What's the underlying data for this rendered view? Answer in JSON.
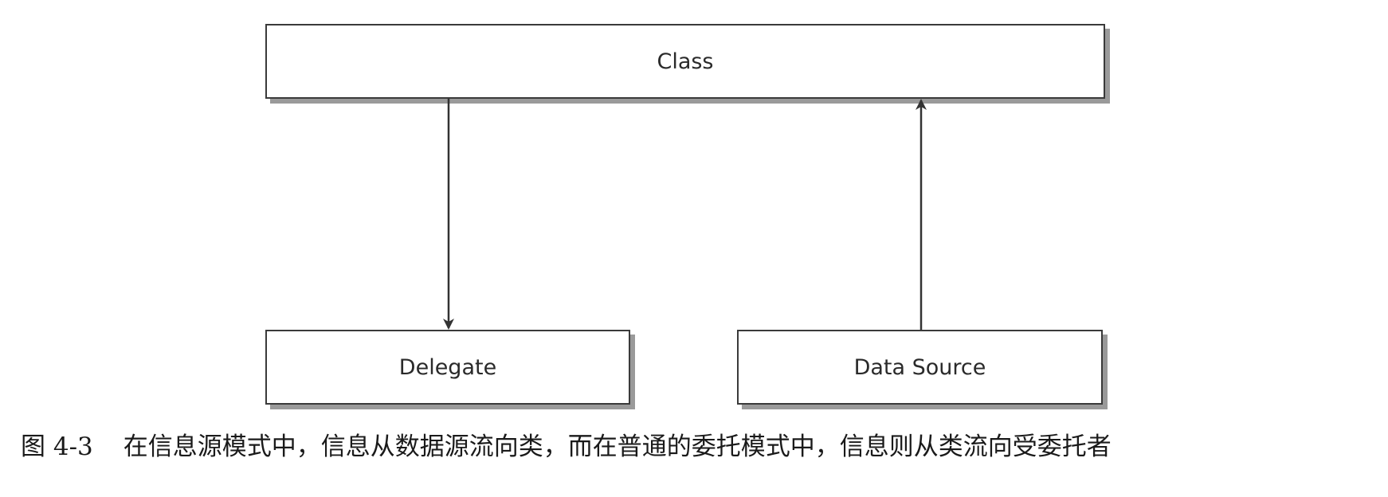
{
  "diagram": {
    "nodes": {
      "class": {
        "label": "Class"
      },
      "delegate": {
        "label": "Delegate"
      },
      "data_source": {
        "label": "Data Source"
      }
    },
    "edges": [
      {
        "from": "class",
        "to": "delegate",
        "direction": "down"
      },
      {
        "from": "data_source",
        "to": "class",
        "direction": "up"
      }
    ]
  },
  "caption": {
    "number": "图 4-3",
    "text": "在信息源模式中，信息从数据源流向类，而在普通的委托模式中，信息则从类流向受委托者"
  },
  "colors": {
    "line": "#333333",
    "border": "#3a3a3a",
    "shadow": "#9a9a9a"
  }
}
